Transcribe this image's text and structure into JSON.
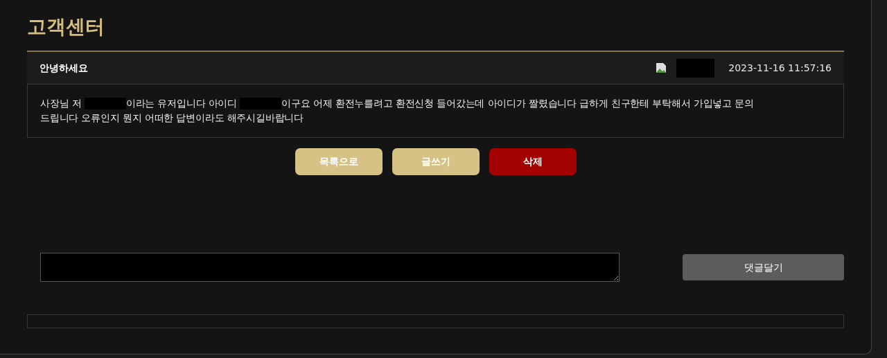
{
  "page_title": "고객센터",
  "post": {
    "subject": "안녕하세요",
    "author": {
      "kind": "redacted"
    },
    "date": "2023-11-16 11:57:16",
    "body": [
      [
        {
          "kind": "text",
          "text": "사장님 저 "
        },
        {
          "kind": "redacted"
        },
        {
          "kind": "text",
          "text": "이라는 유저입니다 아이디 "
        },
        {
          "kind": "redacted"
        },
        {
          "kind": "text",
          "text": "이구요 어제 환전누를려고 환전신청 들어갔는데 아이디가 짤렸습니다 급하게 친구한테 부탁해서 가입넣고 문의"
        }
      ],
      [
        {
          "kind": "text",
          "text": "드립니다 오류인지 뭔지 어떠한 답변이라도 해주시길바랍니다"
        }
      ]
    ]
  },
  "buttons": [
    {
      "label": "목록으로",
      "kind": "normal"
    },
    {
      "label": "글쓰기",
      "kind": "normal"
    },
    {
      "label": "삭제",
      "kind": "danger"
    }
  ],
  "comment": {
    "submit": "댓글달기"
  }
}
